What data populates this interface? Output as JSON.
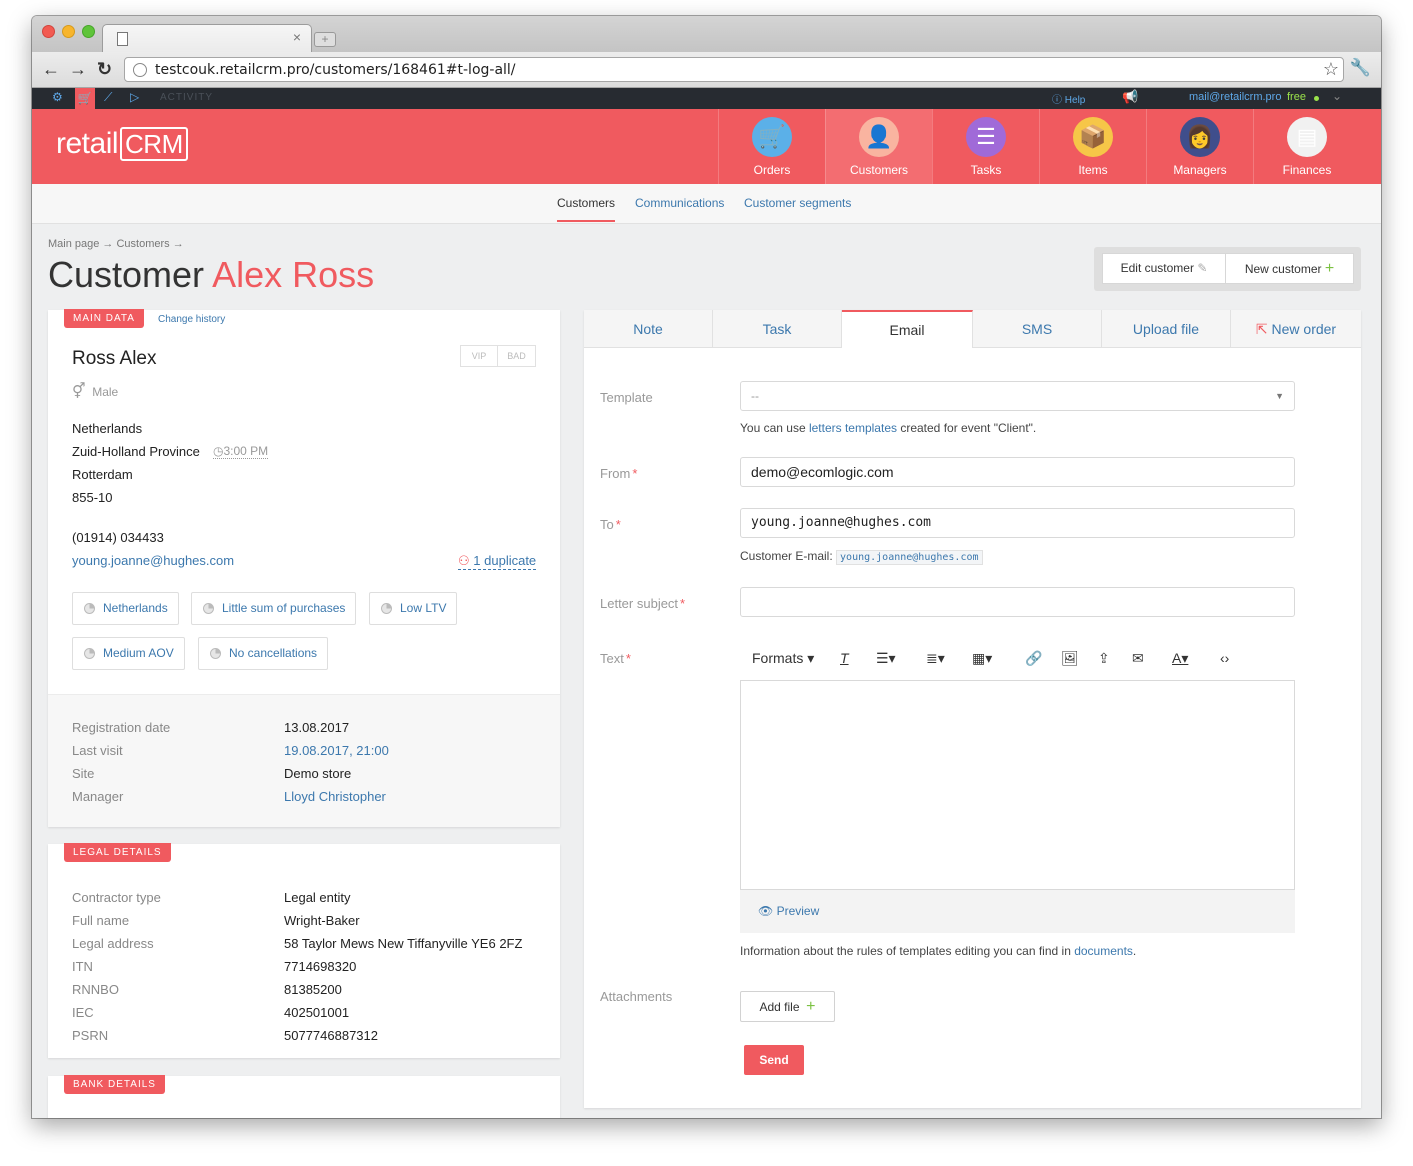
{
  "browser": {
    "url": "testcouk.retailcrm.pro/customers/168461#t-log-all/",
    "new_tab_label": "+",
    "close_tab_label": "×"
  },
  "topstrip": {
    "activity": "ACTIVITY",
    "help": "Help",
    "email": "mail@retailcrm.pro",
    "plan": "free"
  },
  "logo": {
    "pre": "retail",
    "boxed": "CRM"
  },
  "nav": [
    {
      "label": "Orders",
      "icon": "🛒",
      "bg": "#5bb0e8"
    },
    {
      "label": "Customers",
      "icon": "👤",
      "bg": "#f9b4a0"
    },
    {
      "label": "Tasks",
      "icon": "☰",
      "bg": "#a06ad8"
    },
    {
      "label": "Items",
      "icon": "📦",
      "bg": "#f6c648"
    },
    {
      "label": "Managers",
      "icon": "👩",
      "bg": "#3f4e8c"
    },
    {
      "label": "Finances",
      "icon": "▤",
      "bg": "#f1f1f1"
    }
  ],
  "subnav": [
    "Customers",
    "Communications",
    "Customer segments"
  ],
  "breadcrumb": "Main page → Customers →",
  "title": {
    "prefix": "Customer",
    "name": "Alex Ross"
  },
  "actions": {
    "edit": "Edit customer",
    "edit_icon": "✎",
    "new": "New customer",
    "new_icon": "+"
  },
  "main_data": {
    "tag": "MAIN DATA",
    "history": "Change history",
    "name": "Ross Alex",
    "badges": [
      "VIP",
      "BAD"
    ],
    "gender_icon": "⚥",
    "gender": "Male",
    "country": "Netherlands",
    "region": "Zuid-Holland Province",
    "time_icon": "◷",
    "local_time": "3:00 PM",
    "city": "Rotterdam",
    "address": "855-10",
    "phone": "(01914) 034433",
    "email": "young.joanne@hughes.com",
    "dup_icon": "⚇",
    "duplicates": "1 duplicate",
    "segments": [
      "Netherlands",
      "Little sum of purchases",
      "Low LTV",
      "Medium AOV",
      "No cancellations"
    ],
    "info": [
      {
        "label": "Registration date",
        "value": "13.08.2017"
      },
      {
        "label": "Last visit",
        "value": "19.08.2017, 21:00"
      },
      {
        "label": "Site",
        "value": "Demo store"
      },
      {
        "label": "Manager",
        "value": "Lloyd Christopher"
      }
    ]
  },
  "legal": {
    "tag": "LEGAL DETAILS",
    "rows": [
      {
        "label": "Contractor type",
        "value": "Legal entity"
      },
      {
        "label": "Full name",
        "value": "Wright-Baker"
      },
      {
        "label": "Legal address",
        "value": "58 Taylor Mews New Tiffanyville YE6 2FZ"
      },
      {
        "label": "ITN",
        "value": "7714698320"
      },
      {
        "label": "RNNBO",
        "value": "81385200"
      },
      {
        "label": "IEC",
        "value": "402501001"
      },
      {
        "label": "PSRN",
        "value": "5077746887312"
      }
    ]
  },
  "bank": {
    "tag": "BANK DETAILS"
  },
  "tabs": [
    "Note",
    "Task",
    "Email",
    "SMS",
    "Upload file",
    "New order"
  ],
  "new_order_icon": "⇱",
  "email_form": {
    "template_label": "Template",
    "template_value": "--",
    "template_note_pre": "You can use ",
    "template_note_link": "letters templates",
    "template_note_post": " created for event \"Client\".",
    "from_label": "From",
    "from_value": "demo@ecomlogic.com",
    "to_label": "To",
    "to_value": "young.joanne@hughes.com",
    "customer_email_label": "Customer E-mail:",
    "customer_email": "young.joanne@hughes.com",
    "subject_label": "Letter subject",
    "subject_value": "",
    "text_label": "Text",
    "formats": "Formats ▾",
    "preview": "Preview",
    "preview_icon": "👁",
    "docs_note_pre": "Information about the rules of templates editing you can find in ",
    "docs_note_link": "documents",
    "docs_note_post": ".",
    "attachments_label": "Attachments",
    "add_file": "Add file",
    "send": "Send",
    "required_mark": "*"
  }
}
